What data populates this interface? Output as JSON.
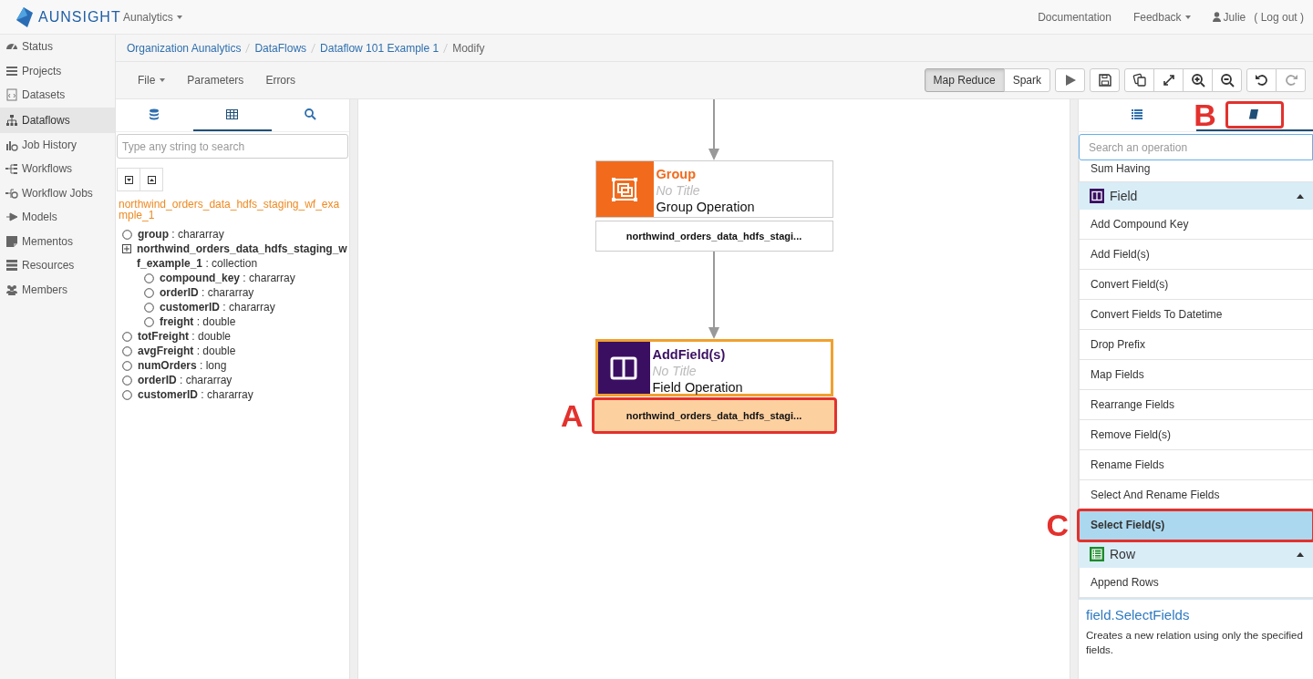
{
  "header": {
    "brand": "AUNSIGHT",
    "org_menu": "Aunalytics",
    "links": [
      {
        "label": "Documentation",
        "kind": "link"
      },
      {
        "label": "Feedback",
        "kind": "menu"
      }
    ],
    "user": "Julie",
    "logout": "( Log out )"
  },
  "sidebar": {
    "items": [
      {
        "label": "Status",
        "kind": "status",
        "selected": false
      },
      {
        "label": "Projects",
        "kind": "projects",
        "selected": false
      },
      {
        "label": "Datasets",
        "kind": "datasets",
        "selected": false
      },
      {
        "label": "Dataflows",
        "kind": "dataflows",
        "selected": true
      },
      {
        "label": "Job History",
        "kind": "history",
        "selected": false
      },
      {
        "label": "Workflows",
        "kind": "workflows",
        "selected": false
      },
      {
        "label": "Workflow Jobs",
        "kind": "workflow-jobs",
        "selected": false
      },
      {
        "label": "Models",
        "kind": "models",
        "selected": false
      },
      {
        "label": "Mementos",
        "kind": "mementos",
        "selected": false
      },
      {
        "label": "Resources",
        "kind": "resources",
        "selected": false
      },
      {
        "label": "Members",
        "kind": "members",
        "selected": false
      }
    ]
  },
  "breadcrumb": [
    {
      "label": "Organization Aunalytics",
      "kind": "link"
    },
    {
      "label": "DataFlows",
      "kind": "link"
    },
    {
      "label": "Dataflow 101 Example 1",
      "kind": "link"
    },
    {
      "label": "Modify",
      "kind": "current"
    }
  ],
  "toolbar": {
    "menus": [
      {
        "label": "File",
        "kind": "dropdown"
      },
      {
        "label": "Parameters",
        "kind": "plain"
      },
      {
        "label": "Errors",
        "kind": "plain"
      }
    ],
    "engines": [
      {
        "label": "Map Reduce",
        "selected": true
      },
      {
        "label": "Spark",
        "selected": false
      }
    ],
    "actions": [
      [
        {
          "kind": "run",
          "disabled": false
        }
      ],
      [
        {
          "kind": "save",
          "disabled": false
        }
      ],
      [
        {
          "kind": "copy",
          "disabled": false
        },
        {
          "kind": "fit",
          "disabled": false
        },
        {
          "kind": "zoom-in",
          "disabled": false
        },
        {
          "kind": "zoom-out",
          "disabled": false
        }
      ],
      [
        {
          "kind": "undo",
          "disabled": false
        },
        {
          "kind": "redo",
          "disabled": true
        }
      ]
    ]
  },
  "schema_panel": {
    "tabs": [
      {
        "kind": "database",
        "selected": false
      },
      {
        "kind": "table",
        "selected": true
      },
      {
        "kind": "search",
        "selected": false
      }
    ],
    "search": {
      "placeholder": "Type any string to search"
    },
    "dataset": "northwind_orders_data_hdfs_staging_wf_example_1",
    "tree": [
      {
        "label": "**group** : chararray",
        "kind": "field"
      },
      {
        "label": "**northwind_orders_data_hdfs_staging_wf_example_1** : collection",
        "kind": "collection",
        "children": [
          {
            "label": "**compound_key** : chararray",
            "kind": "field"
          },
          {
            "label": "**orderID** : chararray",
            "kind": "field"
          },
          {
            "label": "**customerID** : chararray",
            "kind": "field"
          },
          {
            "label": "**freight** : double",
            "kind": "field"
          }
        ]
      },
      {
        "label": "**totFreight** : double",
        "kind": "field"
      },
      {
        "label": "**avgFreight** : double",
        "kind": "field"
      },
      {
        "label": "**numOrders** : long",
        "kind": "field"
      },
      {
        "label": "**orderID** : chararray",
        "kind": "field"
      },
      {
        "label": "**customerID** : chararray",
        "kind": "field"
      }
    ]
  },
  "canvas": {
    "nodes": [
      {
        "kind": "group",
        "title": "Group",
        "subtitle": "No Title",
        "operation": "Group Operation",
        "selected": false,
        "output": "northwind_orders_data_hdfs_stagi...",
        "output_selected": false
      },
      {
        "kind": "field",
        "title": "AddField(s)",
        "subtitle": "No Title",
        "operation": "Field Operation",
        "selected": true,
        "output": "northwind_orders_data_hdfs_stagi...",
        "output_selected": true,
        "callout": "A"
      }
    ]
  },
  "operations_panel": {
    "tabs": [
      {
        "kind": "list",
        "selected": false
      },
      {
        "kind": "book",
        "selected": true,
        "callout": "B"
      }
    ],
    "search": {
      "placeholder": "Search an operation"
    },
    "list": [
      {
        "kind": "item",
        "label": "Sum Having",
        "selected": false
      },
      {
        "kind": "field",
        "label": "Field",
        "expanded": true
      },
      {
        "kind": "item",
        "label": "Add Compound Key",
        "selected": false
      },
      {
        "kind": "item",
        "label": "Add Field(s)",
        "selected": false
      },
      {
        "kind": "item",
        "label": "Convert Field(s)",
        "selected": false
      },
      {
        "kind": "item",
        "label": "Convert Fields To Datetime",
        "selected": false
      },
      {
        "kind": "item",
        "label": "Drop Prefix",
        "selected": false
      },
      {
        "kind": "item",
        "label": "Map Fields",
        "selected": false
      },
      {
        "kind": "item",
        "label": "Rearrange Fields",
        "selected": false
      },
      {
        "kind": "item",
        "label": "Remove Field(s)",
        "selected": false
      },
      {
        "kind": "item",
        "label": "Rename Fields",
        "selected": false
      },
      {
        "kind": "item",
        "label": "Select And Rename Fields",
        "selected": false
      },
      {
        "kind": "item",
        "label": "Select Field(s)",
        "selected": true,
        "callout": "C"
      },
      {
        "kind": "row",
        "label": "Row",
        "expanded": true
      },
      {
        "kind": "item",
        "label": "Append Rows",
        "selected": false
      }
    ],
    "description": {
      "title": "field.SelectFields",
      "text": "Creates a new relation using only the specified fields."
    }
  }
}
